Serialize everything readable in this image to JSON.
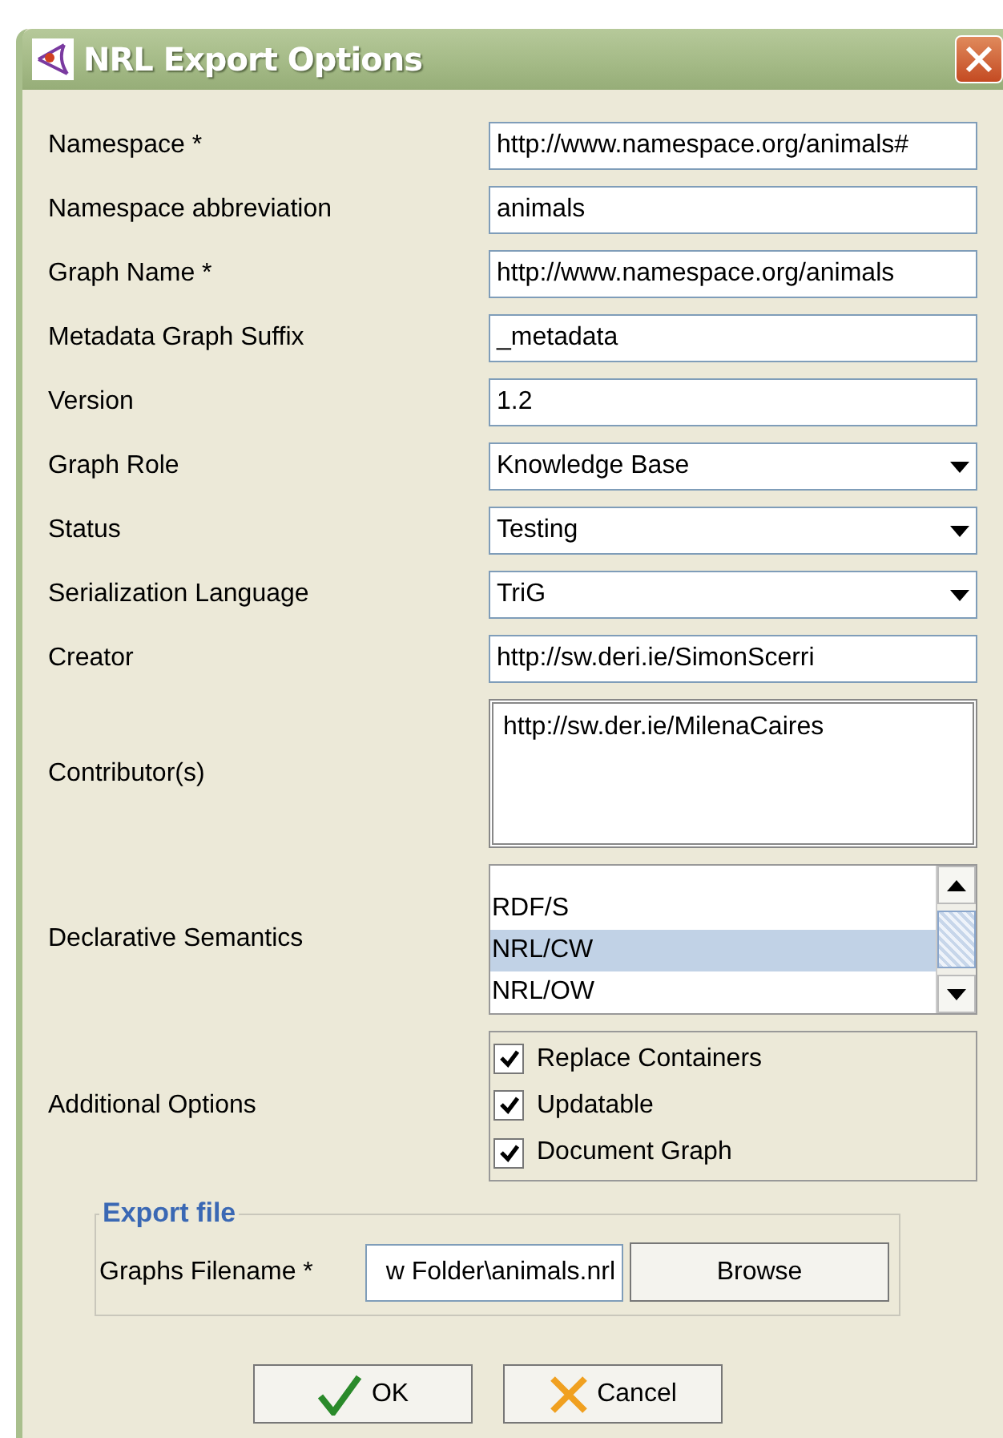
{
  "window": {
    "title": "NRL Export Options"
  },
  "fields": [
    {
      "kind": "text",
      "label": "Namespace *",
      "value": "http://www.namespace.org/animals#"
    },
    {
      "kind": "text",
      "label": "Namespace abbreviation",
      "value": "animals"
    },
    {
      "kind": "text",
      "label": "Graph Name *",
      "value": "http://www.namespace.org/animals"
    },
    {
      "kind": "text",
      "label": "Metadata Graph Suffix",
      "value": "_metadata"
    },
    {
      "kind": "text",
      "label": "Version",
      "value": "1.2"
    },
    {
      "kind": "combo",
      "label": "Graph Role",
      "value": "Knowledge Base"
    },
    {
      "kind": "combo",
      "label": "Status",
      "value": "Testing"
    },
    {
      "kind": "combo",
      "label": "Serialization Language",
      "value": "TriG"
    },
    {
      "kind": "text",
      "label": "Creator",
      "value": "http://sw.deri.ie/SimonScerri"
    },
    {
      "kind": "textarea",
      "label": "Contributor(s)",
      "value": "http://sw.der.ie/MilenaCaires"
    },
    {
      "kind": "list",
      "label": "Declarative Semantics",
      "items": [
        {
          "label": "RDF/S",
          "selected": false
        },
        {
          "label": "NRL/CW",
          "selected": true
        },
        {
          "label": "NRL/OW",
          "selected": false
        }
      ]
    },
    {
      "kind": "checks",
      "label": "Additional Options",
      "items": [
        {
          "label": "Replace Containers",
          "checked": true
        },
        {
          "label": "Updatable",
          "checked": true
        },
        {
          "label": "Document Graph",
          "checked": true
        }
      ]
    }
  ],
  "export_file": {
    "title": "Export file",
    "label": "Graphs Filename *",
    "value": "w Folder\\animals.nrl",
    "button": "Browse"
  },
  "buttons": [
    {
      "kind": "ok",
      "label": "OK"
    },
    {
      "kind": "cancel",
      "label": "Cancel"
    }
  ]
}
